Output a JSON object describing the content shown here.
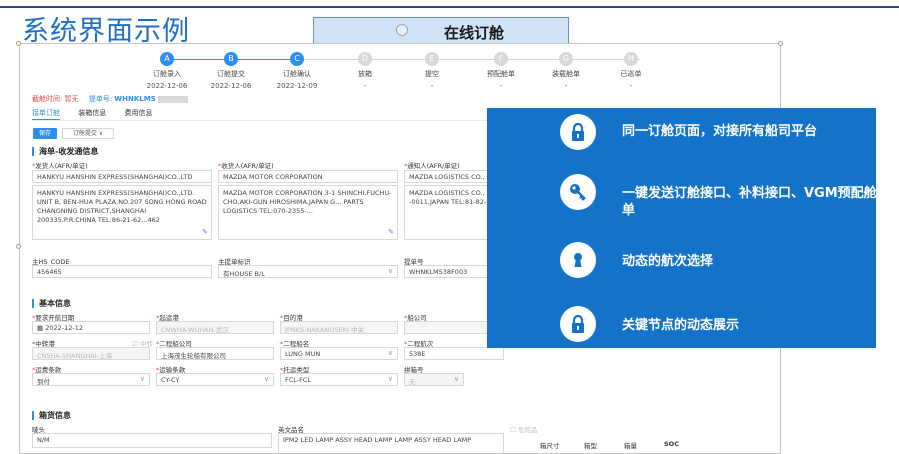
{
  "slide": {
    "title": "系统界面示例",
    "caption": "在线订舱"
  },
  "steps": [
    {
      "label": "订舱录入",
      "date": "2022-12-06",
      "letter": "A",
      "active": true
    },
    {
      "label": "订舱提交",
      "date": "2022-12-06",
      "letter": "B",
      "active": true
    },
    {
      "label": "订舱确认",
      "date": "2022-12-09",
      "letter": "C",
      "active": true
    },
    {
      "label": "放箱",
      "date": "-",
      "letter": "D",
      "active": false
    },
    {
      "label": "提空",
      "date": "-",
      "letter": "E",
      "active": false
    },
    {
      "label": "预配舱单",
      "date": "-",
      "letter": "F",
      "active": false
    },
    {
      "label": "装载舱单",
      "date": "-",
      "letter": "G",
      "active": false
    },
    {
      "label": "已巡单",
      "date": "-",
      "letter": "H",
      "active": false
    }
  ],
  "meta": {
    "deadline_label": "截舱时间:",
    "deadline_value": "暂无",
    "order_label": "提单号:",
    "order_value": "WHNKLMS"
  },
  "tabs": [
    "接单订舱",
    "装箱信息",
    "费用信息"
  ],
  "buttons": {
    "save": "保存",
    "submit": "订舱提交 ∨"
  },
  "section1": {
    "title": "海单-收发通信息",
    "shipper_label": "发货人(AFR/单证)",
    "shipper_value": "HANKYU HANSHIN EXPRESS(SHANGHAI)CO.,LTD",
    "shipper_text": "HANKYU HANSHIN EXPRESS(SHANGHAI)CO.,LTD. UNIT B, BEN-HUA PLAZA,NO.207 SONG HONG ROAD CHANGNING DISTRICT,SHANGHAI 200335,P.R.CHINA TEL:86-21-62...462",
    "consignee_label": "收货人(AFR/单证)",
    "consignee_value": "MAZDA MOTOR CORPORATION",
    "consignee_text": "MAZDA MOTOR CORPORATION 3-1 SHINCHI,FUCHU-CHO,AKI-GUN HIROSHIMA,JAPAN G... PARTS LOGISTICS TEL:070-2355-...",
    "notify_label": "通知人(AFR/单证)",
    "notify_value": "MAZDA LOGISTICS CO.,",
    "notify_text": "MAZDA LOGISTICS CO., 3-... -0011,JAPAN TEL:81-82-...2",
    "hs_label": "主HS_CODE",
    "hs_value": "456465",
    "bl_label": "主提单标识",
    "bl_value": "有HOUSE B/L",
    "bl_no_label": "提单号",
    "bl_no_value": "WHNKLMS38F003"
  },
  "section2": {
    "title": "基本信息",
    "etd_label": "要求开航日期",
    "etd_value": "2022-12-12",
    "pol_label": "起运港",
    "pol_value": "CNWHA-WUHAN-武汉",
    "pod_label": "目的港",
    "pod_value": "JPNKS-NAKANOSEKI-中关",
    "carrier_label": "船公司",
    "transit_label": "中转港",
    "transit_value": "CNSHA-SHANGHAI-上海",
    "transit_check": "中转",
    "second_carrier_label": "二程船公司",
    "second_carrier_value": "上海茂生轮船有限公司",
    "second_vessel_label": "二程船名",
    "second_vessel_value": "LUNG MUN",
    "second_voyage_label": "二程航次",
    "second_voyage_value": "538E",
    "freight_label": "运费条款",
    "freight_value": "到付",
    "transport_label": "运输条款",
    "transport_value": "CY-CY",
    "consign_label": "托运类型",
    "consign_value": "FCL-FCL",
    "lcl_label": "拼箱号",
    "lcl_value": "无"
  },
  "section3": {
    "title": "箱货信息",
    "marks_label": "唛头",
    "marks_value": "N/M",
    "goods_label": "英文品名",
    "goods_value": "IPM2 LED LAMP ASSY HEAD LAMP LAMP ASSY HEAD LAMP",
    "danger_label": "危险品",
    "table_headers": [
      "箱尺寸",
      "箱型",
      "箱量",
      "SOC"
    ]
  },
  "overlay": {
    "items": [
      {
        "text": "同一订舱页面，对接所有船司平台",
        "icon": "lock-icon"
      },
      {
        "text": "一键发送订舱接口、补料接口、VGM预配舱单",
        "icon": "key-icon"
      },
      {
        "text": "动态的航次选择",
        "icon": "keyhole-icon"
      },
      {
        "text": "关键节点的动态展示",
        "icon": "lock-icon"
      }
    ]
  },
  "colors": {
    "brand": "#2e8ef0",
    "overlay": "#1473c8",
    "title": "#1f6fc5"
  }
}
